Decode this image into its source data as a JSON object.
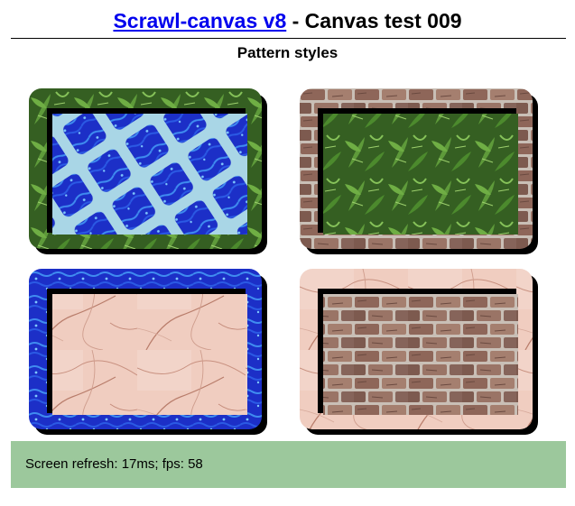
{
  "header": {
    "link_text": "Scrawl-canvas v8",
    "title_rest": " - Canvas test 009",
    "subtitle": "Pattern styles"
  },
  "canvas": {
    "tiles": [
      {
        "frame_pattern": "leaf",
        "fill_pattern": "water-diamonds"
      },
      {
        "frame_pattern": "brick",
        "fill_pattern": "leaf"
      },
      {
        "frame_pattern": "water",
        "fill_pattern": "marble"
      },
      {
        "frame_pattern": "marble",
        "fill_pattern": "brick"
      }
    ]
  },
  "status": {
    "text": "Screen refresh: 17ms; fps: 58"
  },
  "colors": {
    "link": "#0000ee",
    "status_bg": "#9cc89c",
    "leaf": "#3f7a26",
    "water": "#1a2fd0",
    "marble": "#f1cfc4",
    "brick": "#8a6458"
  }
}
